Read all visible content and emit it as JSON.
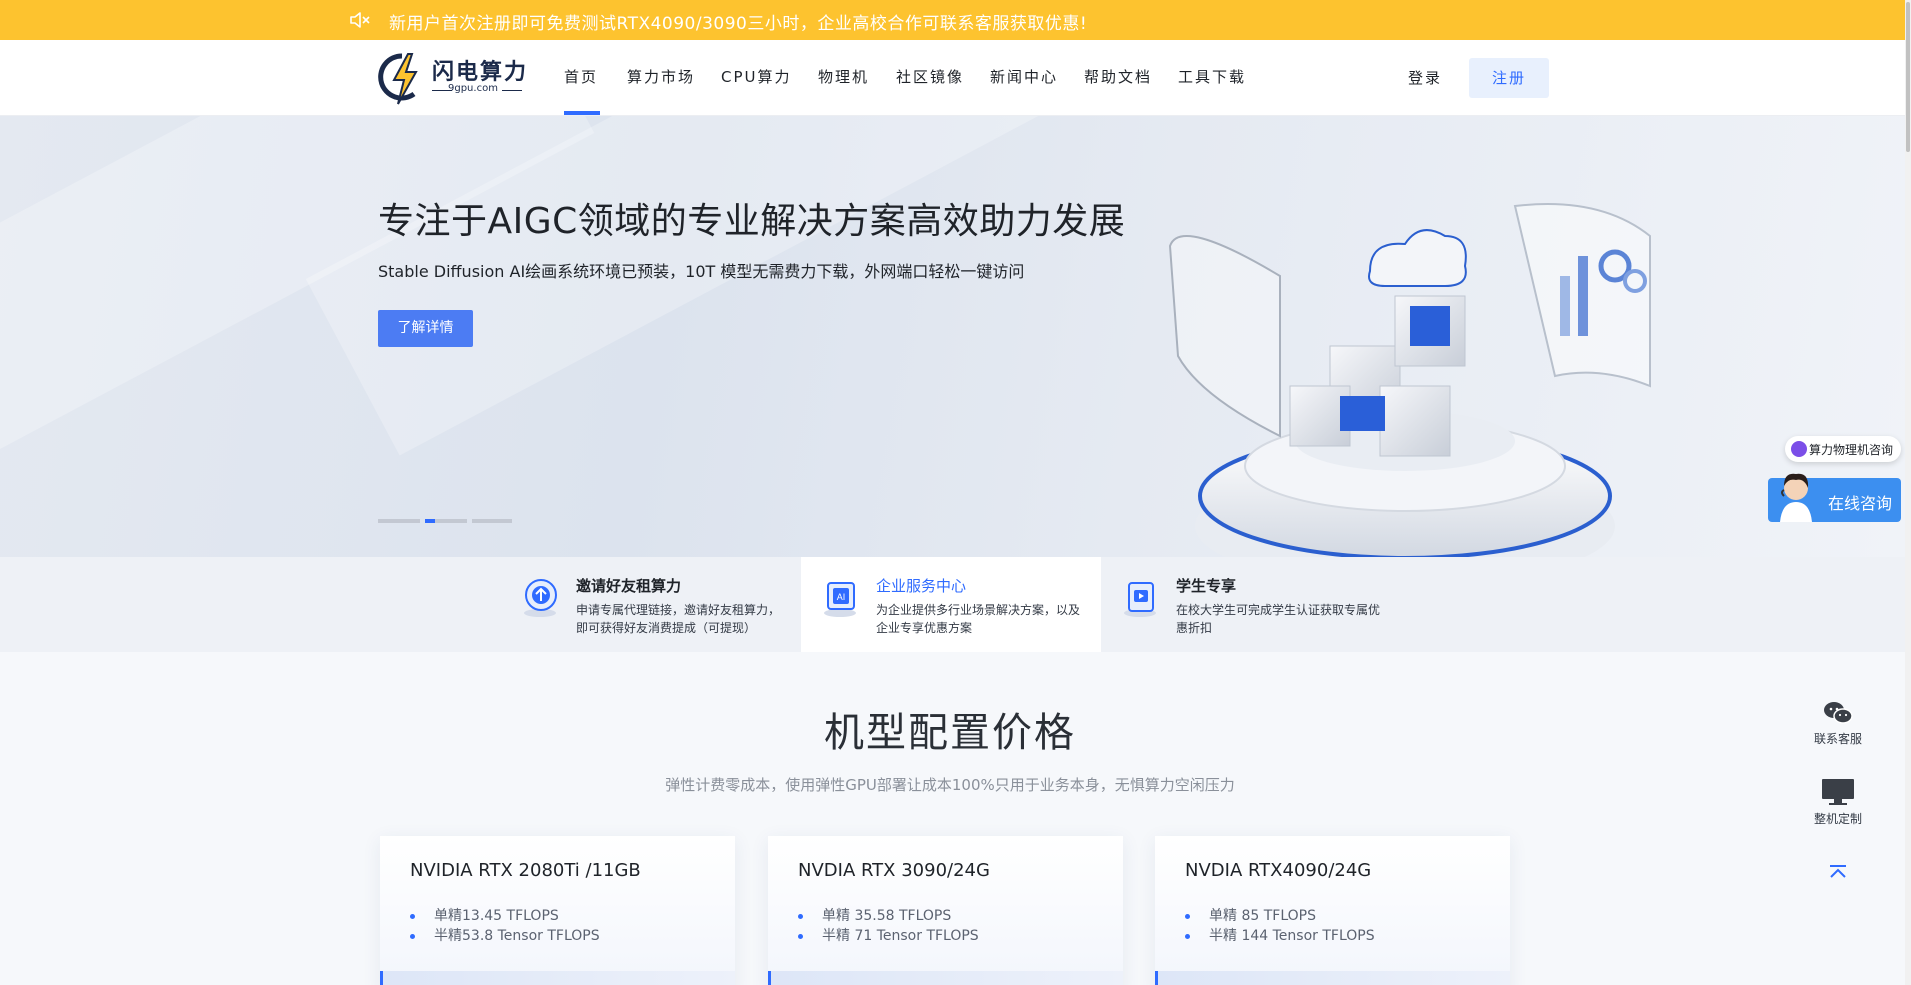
{
  "announcement": {
    "text": "新用户首次注册即可免费测试RTX4090/3090三小时，企业高校合作可联系客服获取优惠!",
    "icon": "speaker-mute-icon"
  },
  "header": {
    "logo": {
      "brand": "闪电算力",
      "domain": "9gpu.com"
    },
    "nav": [
      "首页",
      "算力市场",
      "CPU算力",
      "物理机",
      "社区镜像",
      "新闻中心",
      "帮助文档",
      "工具下载"
    ],
    "active_nav": "首页",
    "login_label": "登录",
    "register_label": "注册"
  },
  "hero": {
    "title": "专注于AIGC领域的专业解决方案高效助力发展",
    "subtitle": "Stable Diffusion AI绘画系统环境已预装，10T 模型无需费力下载，外网端口轻松一键访问",
    "button_label": "了解详情",
    "slide_count": 3,
    "active_slide": 2
  },
  "features": [
    {
      "title": "邀请好友租算力",
      "desc": "申请专属代理链接，邀请好友租算力，即可获得好友消费提成（可提现）",
      "icon": "invite-icon"
    },
    {
      "title": "企业服务中心",
      "desc": "为企业提供多行业场景解决方案，以及企业专享优惠方案",
      "icon": "ai-chip-icon"
    },
    {
      "title": "学生专享",
      "desc": "在校大学生可完成学生认证获取专属优惠折扣",
      "icon": "student-icon"
    }
  ],
  "pricing": {
    "title": "机型配置价格",
    "subtitle": "弹性计费零成本，使用弹性GPU部署让成本100%只用于业务本身，无惧算力空闲压力",
    "cards": [
      {
        "name": "NVIDIA RTX 2080Ti /11GB",
        "specs": [
          "单精13.45 TFLOPS",
          "半精53.8 Tensor TFLOPS"
        ]
      },
      {
        "name": "NVDIA RTX 3090/24G",
        "specs": [
          "单精 35.58 TFLOPS",
          "半精 71 Tensor TFLOPS"
        ]
      },
      {
        "name": "NVDIA RTX4090/24G",
        "specs": [
          "单精 85 TFLOPS",
          "半精 144 Tensor TFLOPS"
        ]
      }
    ]
  },
  "floating": {
    "consult_label": "算力物理机咨询",
    "online_label": "在线咨询",
    "contact_label": "联系客服",
    "custom_label": "整机定制"
  },
  "colors": {
    "announce_bg": "#fdc32f",
    "accent": "#2f6bff",
    "button": "#4c7cf3"
  }
}
